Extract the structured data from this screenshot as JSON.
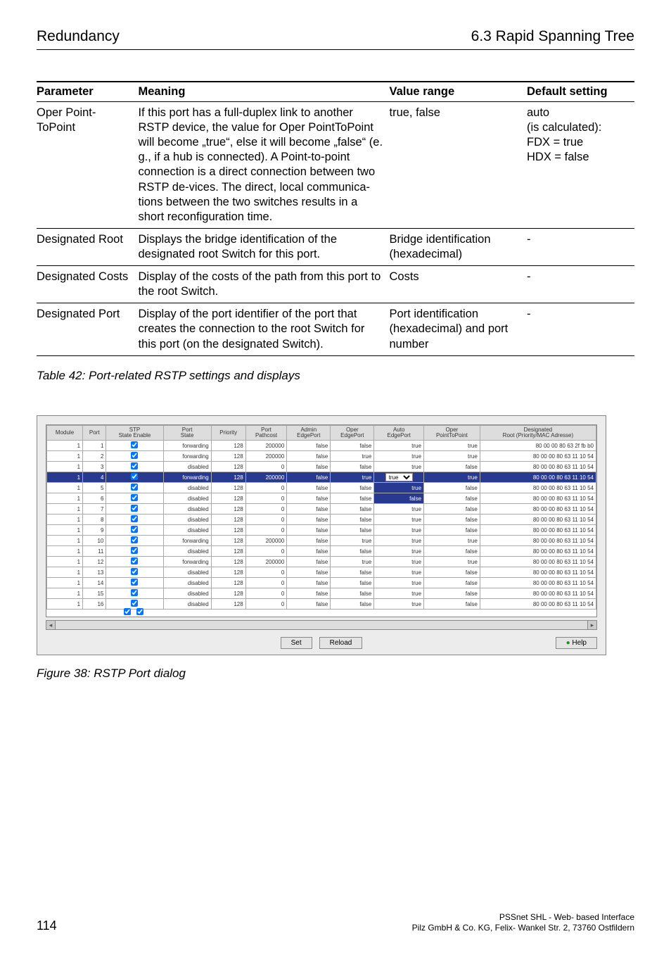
{
  "header": {
    "left": "Redundancy",
    "right": "6.3 Rapid Spanning Tree"
  },
  "paramTable": {
    "columns": [
      "Parameter",
      "Meaning",
      "Value range",
      "Default setting"
    ],
    "rows": [
      {
        "parameter": "Oper Point-ToPoint",
        "meaning": "If this port has a full-duplex link to another RSTP device, the value for Oper PointToPoint will become „true“, else it will become „false“ (e. g., if a hub is connected). A Point-to-point connection is a direct connection between two RSTP de-vices. The direct, local communica-tions between the two switches results in a short reconfiguration time.",
        "range": "true, false",
        "default": "auto\n(is calculated):\nFDX = true\nHDX = false"
      },
      {
        "parameter": "Designated Root",
        "meaning": "Displays the bridge identification of the designated root Switch for this port.",
        "range": "Bridge identification (hexadecimal)",
        "default": "-"
      },
      {
        "parameter": "Designated Costs",
        "meaning": "Display of the costs of the path from this port to the root Switch.",
        "range": "Costs",
        "default": "-"
      },
      {
        "parameter": "Designated Port",
        "meaning": "Display of the port identifier of the port that creates the connection to the root Switch for this port (on the designated Switch).",
        "range": "Port identification (hexadecimal) and port number",
        "default": "-"
      }
    ]
  },
  "tableCaption": "Table 42: Port-related RSTP settings and displays",
  "shot": {
    "columns": [
      "Module",
      "Port",
      "STP State Enable",
      "Port State",
      "Priority",
      "Port Pathcost",
      "Admin EdgePort",
      "Oper EdgePort",
      "Auto EdgePort",
      "Oper PointToPoint",
      "Designated Root (Priority/MAC Adresse)"
    ],
    "autoOptions": [
      "true",
      "false"
    ],
    "rows": [
      {
        "mod": 1,
        "port": 1,
        "en": true,
        "state": "forwarding",
        "pri": 128,
        "cost": 200000,
        "adm": "false",
        "oper": "false",
        "auto": "true",
        "ptp": "true",
        "root": "80 00 00 80 63 2f fb b0",
        "hl": false
      },
      {
        "mod": 1,
        "port": 2,
        "en": true,
        "state": "forwarding",
        "pri": 128,
        "cost": 200000,
        "adm": "false",
        "oper": "true",
        "auto": "true",
        "ptp": "true",
        "root": "80 00 00 80 63 11 10 54",
        "hl": false
      },
      {
        "mod": 1,
        "port": 3,
        "en": true,
        "state": "disabled",
        "pri": 128,
        "cost": 0,
        "adm": "false",
        "oper": "false",
        "auto": "true",
        "ptp": "false",
        "root": "80 00 00 80 63 11 10 54",
        "hl": false
      },
      {
        "mod": 1,
        "port": 4,
        "en": true,
        "state": "forwarding",
        "pri": 128,
        "cost": 200000,
        "adm": "false",
        "oper": "true",
        "auto": "true",
        "ptp": "true",
        "root": "80 00 00 80 63 11 10 54",
        "hl": true
      },
      {
        "mod": 1,
        "port": 5,
        "en": true,
        "state": "disabled",
        "pri": 128,
        "cost": 0,
        "adm": "false",
        "oper": "false",
        "auto": "true",
        "ptp": "false",
        "root": "80 00 00 80 63 11 10 54",
        "hl": false,
        "autoHi": true
      },
      {
        "mod": 1,
        "port": 6,
        "en": true,
        "state": "disabled",
        "pri": 128,
        "cost": 0,
        "adm": "false",
        "oper": "false",
        "auto": "false",
        "ptp": "false",
        "root": "80 00 00 80 63 11 10 54",
        "hl": false,
        "autoHi": true
      },
      {
        "mod": 1,
        "port": 7,
        "en": true,
        "state": "disabled",
        "pri": 128,
        "cost": 0,
        "adm": "false",
        "oper": "false",
        "auto": "true",
        "ptp": "false",
        "root": "80 00 00 80 63 11 10 54",
        "hl": false
      },
      {
        "mod": 1,
        "port": 8,
        "en": true,
        "state": "disabled",
        "pri": 128,
        "cost": 0,
        "adm": "false",
        "oper": "false",
        "auto": "true",
        "ptp": "false",
        "root": "80 00 00 80 63 11 10 54",
        "hl": false
      },
      {
        "mod": 1,
        "port": 9,
        "en": true,
        "state": "disabled",
        "pri": 128,
        "cost": 0,
        "adm": "false",
        "oper": "false",
        "auto": "true",
        "ptp": "false",
        "root": "80 00 00 80 63 11 10 54",
        "hl": false
      },
      {
        "mod": 1,
        "port": 10,
        "en": true,
        "state": "forwarding",
        "pri": 128,
        "cost": 200000,
        "adm": "false",
        "oper": "true",
        "auto": "true",
        "ptp": "true",
        "root": "80 00 00 80 63 11 10 54",
        "hl": false
      },
      {
        "mod": 1,
        "port": 11,
        "en": true,
        "state": "disabled",
        "pri": 128,
        "cost": 0,
        "adm": "false",
        "oper": "false",
        "auto": "true",
        "ptp": "false",
        "root": "80 00 00 80 63 11 10 54",
        "hl": false
      },
      {
        "mod": 1,
        "port": 12,
        "en": true,
        "state": "forwarding",
        "pri": 128,
        "cost": 200000,
        "adm": "false",
        "oper": "true",
        "auto": "true",
        "ptp": "true",
        "root": "80 00 00 80 63 11 10 54",
        "hl": false
      },
      {
        "mod": 1,
        "port": 13,
        "en": true,
        "state": "disabled",
        "pri": 128,
        "cost": 0,
        "adm": "false",
        "oper": "false",
        "auto": "true",
        "ptp": "false",
        "root": "80 00 00 80 63 11 10 54",
        "hl": false
      },
      {
        "mod": 1,
        "port": 14,
        "en": true,
        "state": "disabled",
        "pri": 128,
        "cost": 0,
        "adm": "false",
        "oper": "false",
        "auto": "true",
        "ptp": "false",
        "root": "80 00 00 80 63 11 10 54",
        "hl": false
      },
      {
        "mod": 1,
        "port": 15,
        "en": true,
        "state": "disabled",
        "pri": 128,
        "cost": 0,
        "adm": "false",
        "oper": "false",
        "auto": "true",
        "ptp": "false",
        "root": "80 00 00 80 63 11 10 54",
        "hl": false
      },
      {
        "mod": 1,
        "port": 16,
        "en": true,
        "state": "disabled",
        "pri": 128,
        "cost": 0,
        "adm": "false",
        "oper": "false",
        "auto": "true",
        "ptp": "false",
        "root": "80 00 00 80 63 11 10 54",
        "hl": false
      }
    ]
  },
  "buttons": {
    "set": "Set",
    "reload": "Reload",
    "help": "Help"
  },
  "figureCaption": "Figure 38: RSTP Port dialog",
  "footer": {
    "page": "114",
    "product": "PSSnet SHL - Web- based Interface",
    "company": "Pilz GmbH & Co. KG, Felix- Wankel Str. 2, 73760 Ostfildern"
  }
}
